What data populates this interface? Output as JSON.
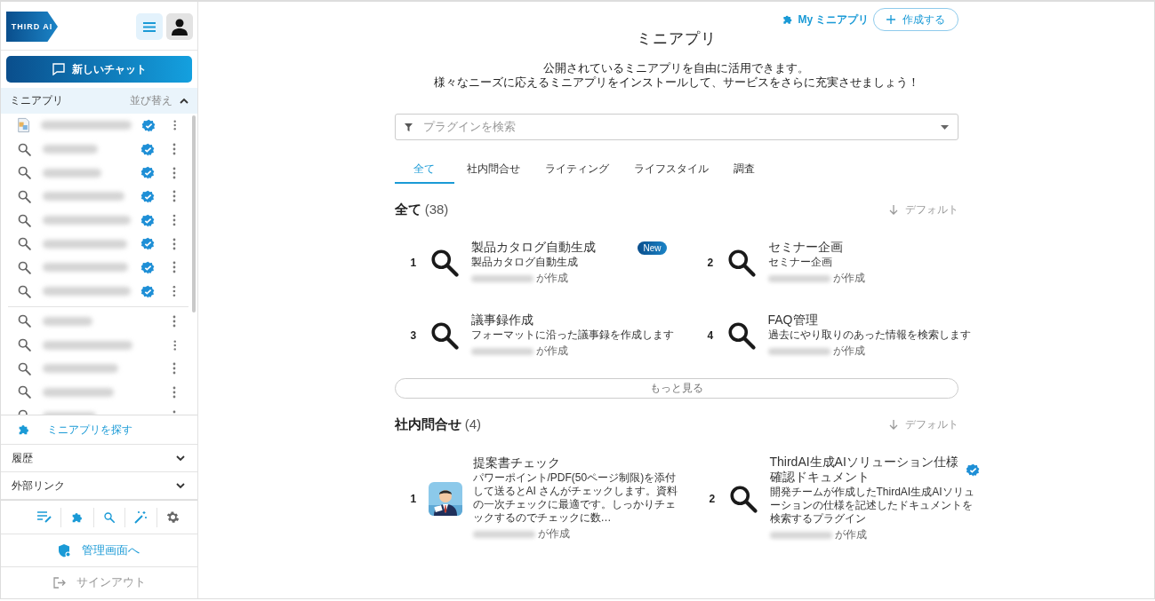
{
  "sidebar": {
    "logo": "THIRD AI",
    "new_chat": "新しいチャット",
    "section": {
      "title": "ミニアプリ",
      "sort": "並び替え",
      "expanded": true
    },
    "items": [
      {
        "kind": "document",
        "verified": true
      },
      {
        "kind": "search",
        "verified": true
      },
      {
        "kind": "search",
        "verified": true
      },
      {
        "kind": "search",
        "verified": true
      },
      {
        "kind": "search",
        "verified": true
      },
      {
        "kind": "search",
        "verified": true
      },
      {
        "kind": "search",
        "verified": true
      },
      {
        "kind": "search",
        "verified": true
      },
      {
        "kind": "search",
        "verified": false
      },
      {
        "kind": "search",
        "verified": false
      },
      {
        "kind": "search",
        "verified": false
      },
      {
        "kind": "search",
        "verified": false
      },
      {
        "kind": "search",
        "verified": false
      }
    ],
    "find": "ミニアプリを探す",
    "collapsibles": [
      {
        "label": "履歴",
        "expanded": false
      },
      {
        "label": "外部リンク",
        "expanded": false
      }
    ],
    "admin": "管理画面へ",
    "signout": "サインアウト"
  },
  "main": {
    "my_apps": "My ミニアプリ",
    "create": "作成する",
    "title": "ミニアプリ",
    "description": [
      "公開されているミニアプリを自由に活用できます。",
      "様々なニーズに応えるミニアプリをインストールして、サービスをさらに充実させましょう！"
    ],
    "search": {
      "placeholder": "プラグインを検索"
    },
    "tabs": [
      {
        "label": "全て",
        "selected": true
      },
      {
        "label": "社内問合せ",
        "selected": false
      },
      {
        "label": "ライティング",
        "selected": false
      },
      {
        "label": "ライフスタイル",
        "selected": false
      },
      {
        "label": "調査",
        "selected": false
      }
    ],
    "sections": [
      {
        "title": "全て",
        "count": "(38)",
        "sort": "デフォルト",
        "more": "もっと見る",
        "cards": [
          {
            "rank": "1",
            "kind": "search",
            "title": "製品カタログ自動生成",
            "description": "製品カタログ自動生成",
            "author_suffix": "が作成",
            "badge": "New",
            "verified": false
          },
          {
            "rank": "2",
            "kind": "search",
            "title": "セミナー企画",
            "description": "セミナー企画",
            "author_suffix": "が作成",
            "verified": false
          },
          {
            "rank": "3",
            "kind": "search",
            "title": "議事録作成",
            "description": "フォーマットに沿った議事録を作成します",
            "author_suffix": "が作成",
            "verified": false
          },
          {
            "rank": "4",
            "kind": "search",
            "title": "FAQ管理",
            "description": "過去にやり取りのあった情報を検索します",
            "author_suffix": "が作成",
            "verified": false
          }
        ]
      },
      {
        "title": "社内問合せ",
        "count": "(4)",
        "sort": "デフォルト",
        "cards": [
          {
            "rank": "1",
            "kind": "picture",
            "title": "提案書チェック",
            "description": "パワーポイント/PDF(50ページ制限)を添付して送るとAI さんがチェックします。資料の一次チェックに最適です。しっかりチェックするのでチェックに数…",
            "author_suffix": "が作成",
            "verified": false
          },
          {
            "rank": "2",
            "kind": "search",
            "title": "ThirdAI生成AIソリューション仕様確認ドキュメント",
            "description": "開発チームが作成したThirdAI生成AIソリューションの仕様を記述したドキュメントを検索するプラグイン",
            "author_suffix": "が作成",
            "verified": true
          }
        ]
      }
    ]
  }
}
